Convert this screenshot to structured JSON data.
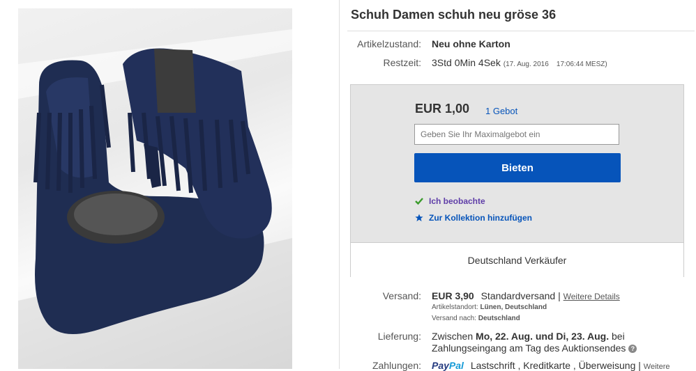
{
  "listing": {
    "title": "Schuh Damen schuh neu gröse 36",
    "condition_label": "Artikelzustand:",
    "condition_value": "Neu ohne Karton",
    "time_label": "Restzeit:",
    "time_value": "3Std 0Min 4Sek",
    "time_end": "(17. Aug. 2016    17:06:44 MESZ)"
  },
  "bid": {
    "price": "EUR 1,00",
    "bid_count": "1 Gebot",
    "max_bid_placeholder": "Geben Sie Ihr Maximalgebot ein",
    "bid_button": "Bieten",
    "watch_label": "Ich beobachte",
    "collection_label": "Zur Kollektion hinzufügen",
    "seller_location": "Deutschland Verkäufer"
  },
  "shipping": {
    "label": "Versand:",
    "cost": "EUR 3,90",
    "method": "Standardversand |",
    "details_link": "Weitere Details",
    "location_label": "Artikelstandort:",
    "location_value": "Lünen, Deutschland",
    "ships_to_label": "Versand nach:",
    "ships_to_value": "Deutschland"
  },
  "delivery": {
    "label": "Lieferung:",
    "text_prefix": "Zwischen ",
    "dates": "Mo, 22. Aug. und Di, 23. Aug.",
    "text_suffix": " bei",
    "line2": "Zahlungseingang am Tag des Auktionsendes"
  },
  "payment": {
    "label": "Zahlungen:",
    "paypal_a": "Pay",
    "paypal_b": "Pal",
    "methods": "Lastschrift , Kreditkarte , Überweisung |",
    "more": "Weitere"
  },
  "colors": {
    "accent_blue": "#0654ba",
    "watch_purple": "#5f3ea8",
    "check_green": "#3a9b2b"
  }
}
